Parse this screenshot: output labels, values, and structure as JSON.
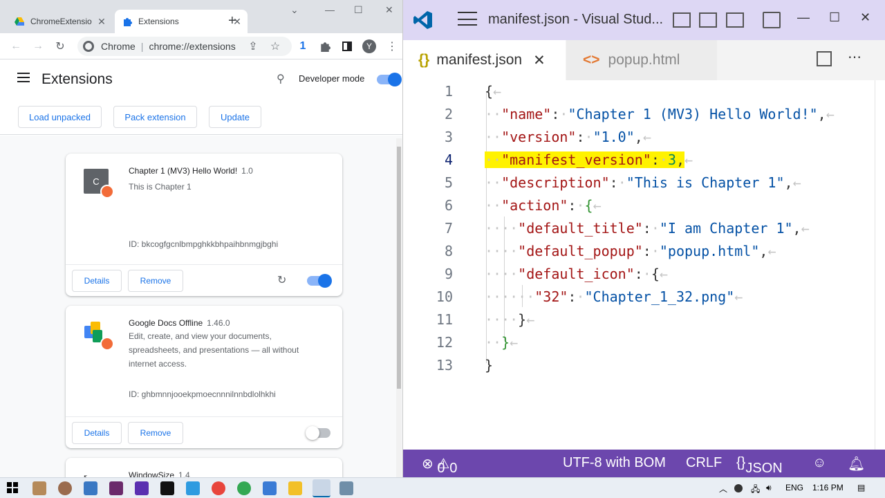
{
  "chrome": {
    "tabs": [
      {
        "title": "ChromeExtensio",
        "active": false
      },
      {
        "title": "Extensions",
        "active": true
      }
    ],
    "omnibox": {
      "site": "Chrome",
      "url": "chrome://extensions"
    },
    "extension_count": "1",
    "profile_initial": "Y",
    "page_title": "Extensions",
    "developer_mode_label": "Developer mode",
    "developer_mode_on": true,
    "buttons": {
      "load_unpacked": "Load unpacked",
      "pack_extension": "Pack extension",
      "update": "Update"
    },
    "extensions": [
      {
        "name": "Chapter 1 (MV3) Hello World!",
        "version": "1.0",
        "description": "This is Chapter 1",
        "id": "ID: bkcogfgcnlbmpghkkbhpaihbnmgjbghi",
        "details": "Details",
        "remove": "Remove",
        "enabled": true,
        "icon_letter": "C"
      },
      {
        "name": "Google Docs Offline",
        "version": "1.46.0",
        "description": "Edit, create, and view your documents, spreadsheets, and presentations — all without internet access.",
        "id": "ID: ghbmnnjooekpmoecnnnilnnbdlolhkhi",
        "details": "Details",
        "remove": "Remove",
        "enabled": false
      },
      {
        "name": "WindowSize",
        "version": "1.4"
      }
    ]
  },
  "vscode": {
    "window_title": "manifest.json - Visual Stud...",
    "tabs": [
      {
        "icon": "{}",
        "label": "manifest.json",
        "active": true
      },
      {
        "icon": "<>",
        "label": "popup.html",
        "active": false
      }
    ],
    "line_numbers": [
      "1",
      "2",
      "3",
      "4",
      "5",
      "6",
      "7",
      "8",
      "9",
      "10",
      "11",
      "12",
      "13"
    ],
    "code": {
      "l1": "{",
      "l2_key": "\"name\"",
      "l2_val": "\"Chapter 1 (MV3) Hello World!\"",
      "l3_key": "\"version\"",
      "l3_val": "\"1.0\"",
      "l4_key": "\"manifest_version\"",
      "l4_val": "3",
      "l5_key": "\"description\"",
      "l5_val": "\"This is Chapter 1\"",
      "l6_key": "\"action\"",
      "l7_key": "\"default_title\"",
      "l7_val": "\"I am Chapter 1\"",
      "l8_key": "\"default_popup\"",
      "l8_val": "\"popup.html\"",
      "l9_key": "\"default_icon\"",
      "l10_key": "\"32\"",
      "l10_val": "\"Chapter_1_32.png\"",
      "l13": "}"
    },
    "status": {
      "errors": "0",
      "warnings": "0",
      "encoding": "UTF-8 with BOM",
      "eol": "CRLF",
      "language": "JSON"
    }
  },
  "taskbar": {
    "lang": "ENG",
    "time": "1:16 PM"
  },
  "colors": {
    "vscode_status": "#6c47ad",
    "vscode_title": "#ddd7f4",
    "chrome_blue": "#1a73e8",
    "highlight": "#fff200"
  }
}
